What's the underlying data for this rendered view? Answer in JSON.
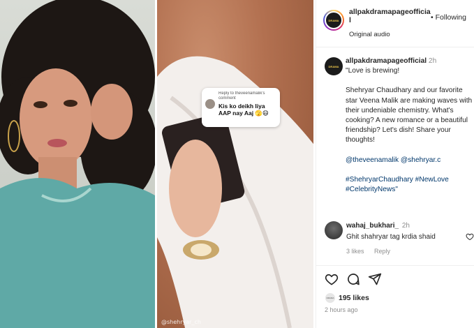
{
  "post": {
    "username": "allpakdramapageofficial",
    "follow_dot": "•",
    "follow_label": "Following",
    "audio_label": "Original audio",
    "avatar_label": "DRAMA"
  },
  "video": {
    "reply_header": "Reply to theveenamalik's comment",
    "reply_text": "Kis ko deikh liya AAP nay Aaj 🫣😄",
    "watermark": "@shehryar_ch"
  },
  "caption": {
    "username": "allpakdramapageofficial",
    "time": "2h",
    "para1": "\"Love is brewing!",
    "para2": "Shehryar Chaudhary and our favorite star Veena Malik are making waves with their undeniable chemistry. What's cooking? A new romance or a beautiful friendship? Let's dish! Share your thoughts!",
    "mentions": "@theveenamalik @shehryar.c",
    "hashtags": "#ShehryarChaudhary #NewLove #CelebrityNews\""
  },
  "comment": {
    "username": "wahaj_bukhari_",
    "time": "2h",
    "text": "Ghit shahryar tag krdia shaid",
    "likes": "3 likes",
    "reply_label": "Reply"
  },
  "actions": {
    "like_icon": "heart-icon",
    "comment_icon": "comment-icon",
    "share_icon": "paper-plane-icon",
    "likes_count": "195 likes",
    "likes_avatar_label": "DRAMA",
    "timestamp": "2 hours ago"
  },
  "colors": {
    "link": "#00376b",
    "muted": "#8e8e8e",
    "text": "#262626"
  }
}
